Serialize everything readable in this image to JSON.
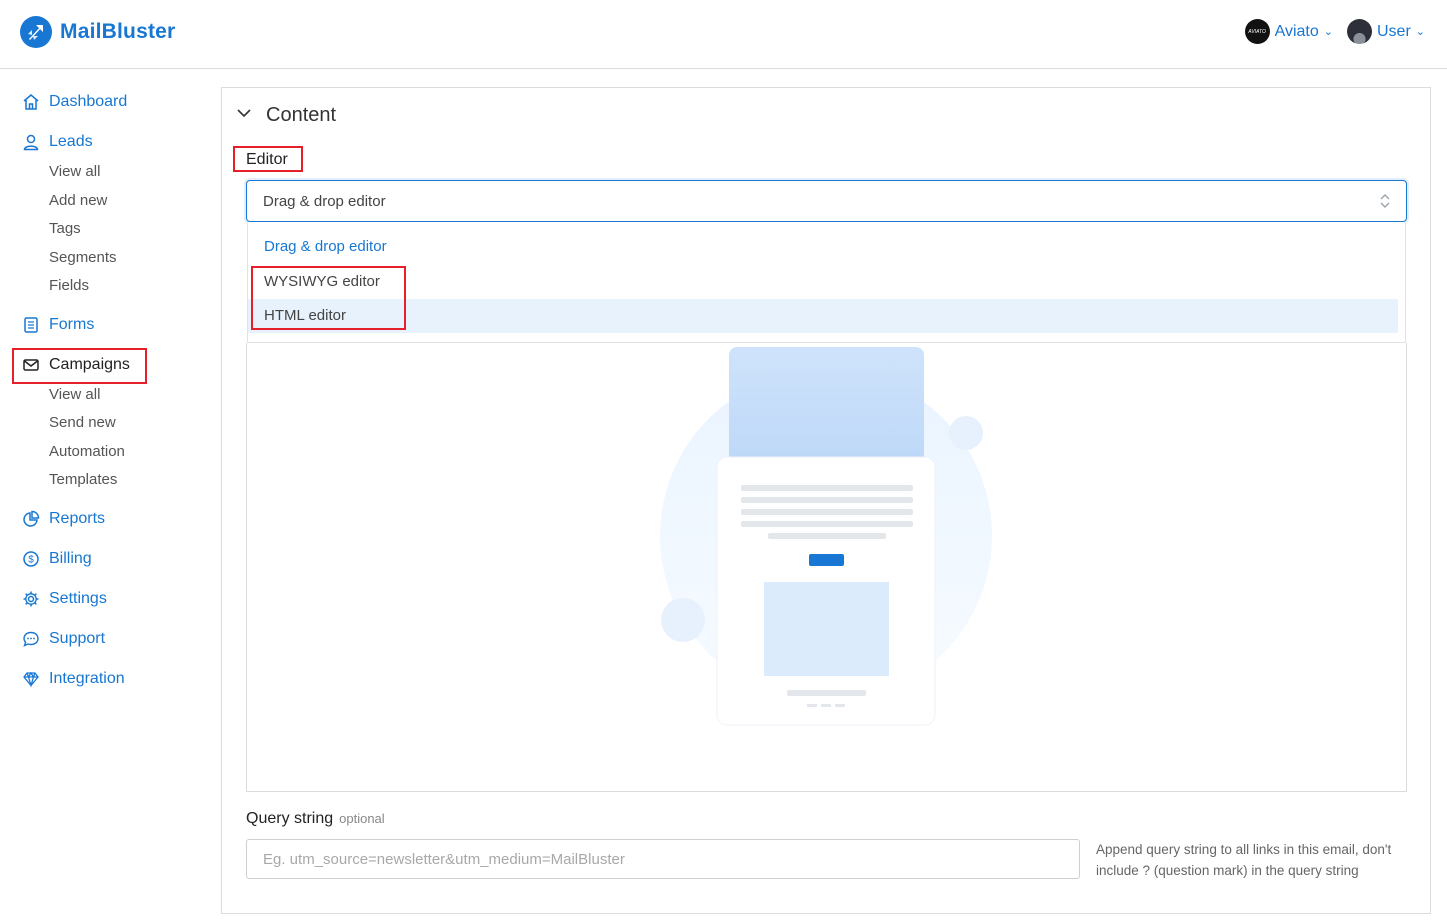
{
  "app": {
    "name": "MailBluster"
  },
  "header": {
    "brand_account": "Aviato",
    "user": "User",
    "brand_avatar_text": "AVIATO"
  },
  "sidebar": {
    "dashboard": "Dashboard",
    "leads": "Leads",
    "leads_sub": [
      "View all",
      "Add new",
      "Tags",
      "Segments",
      "Fields"
    ],
    "forms": "Forms",
    "campaigns": "Campaigns",
    "campaigns_sub": [
      "View all",
      "Send new",
      "Automation",
      "Templates"
    ],
    "reports": "Reports",
    "billing": "Billing",
    "settings": "Settings",
    "support": "Support",
    "integration": "Integration"
  },
  "content": {
    "section_title": "Content",
    "editor_label": "Editor",
    "editor_selected": "Drag & drop editor",
    "editor_options": [
      "Drag & drop editor",
      "WYSIWYG editor",
      "HTML editor"
    ],
    "query_label": "Query string",
    "query_optional": "optional",
    "query_placeholder": "Eg. utm_source=newsletter&utm_medium=MailBluster",
    "query_help": "Append query string to all links in this email, don't include ? (question mark) in the query string"
  },
  "colors": {
    "accent": "#1877d2",
    "highlight": "#e5202a",
    "hover": "#e7f2fd"
  }
}
